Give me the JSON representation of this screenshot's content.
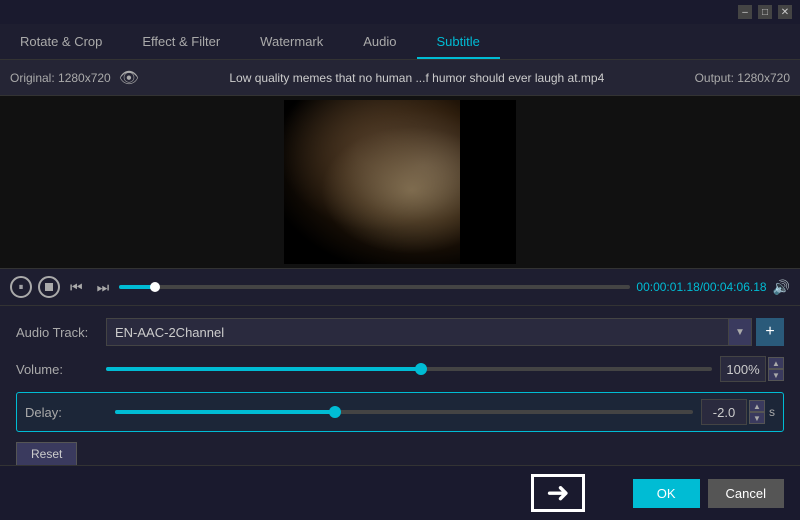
{
  "titlebar": {
    "minimize_label": "–",
    "maximize_label": "□",
    "close_label": "✕"
  },
  "tabs": {
    "items": [
      {
        "id": "rotate-crop",
        "label": "Rotate & Crop"
      },
      {
        "id": "effect-filter",
        "label": "Effect & Filter"
      },
      {
        "id": "watermark",
        "label": "Watermark"
      },
      {
        "id": "audio",
        "label": "Audio"
      },
      {
        "id": "subtitle",
        "label": "Subtitle"
      }
    ],
    "active": "subtitle"
  },
  "header": {
    "original_label": "Original: 1280x720",
    "file_name": "Low quality memes that no human ...f humor should ever laugh at.mp4",
    "output_label": "Output: 1280x720"
  },
  "controls": {
    "time_current": "00:00:01.18",
    "time_total": "00:04:06.18",
    "time_separator": "/"
  },
  "audio": {
    "track_label": "Audio Track:",
    "track_value": "EN-AAC-2Channel",
    "volume_label": "Volume:",
    "volume_value": "100%",
    "delay_label": "Delay:",
    "delay_value": "-2.0",
    "delay_unit": "s",
    "reset_label": "Reset"
  },
  "bottom": {
    "ok_label": "OK",
    "cancel_label": "Cancel"
  }
}
